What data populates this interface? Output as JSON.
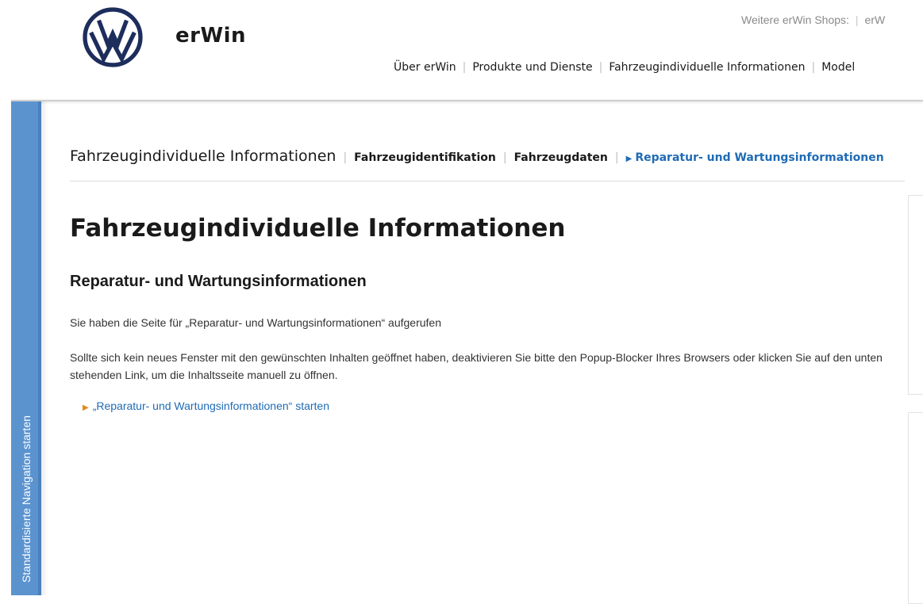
{
  "brand": {
    "name": "erWin",
    "logo": "vw-logo"
  },
  "shops": {
    "label": "Weitere erWin Shops:",
    "next": "erW"
  },
  "topnav": {
    "items": [
      "Über erWin",
      "Produkte und Dienste",
      "Fahrzeugindividuelle Informationen",
      "Model"
    ]
  },
  "sidetab": {
    "label": "Standardisierte Navigation starten",
    "color": "#5b93cf"
  },
  "subnav": {
    "main": "Fahrzeugindividuelle Informationen",
    "items": [
      "Fahrzeugidentifikation",
      "Fahrzeugdaten"
    ],
    "active": "Reparatur- und Wartungsinformationen"
  },
  "content": {
    "title": "Fahrzeugindividuelle Informationen",
    "section_title": "Reparatur- und Wartungsinformationen",
    "para1": "Sie haben die Seite für „Reparatur- und Wartungsinformationen“ aufgerufen",
    "para2": "Sollte sich kein neues Fenster mit den gewünschten Inhalten geöffnet haben, deaktivieren Sie bitte den Popup-Blocker Ihres Browsers oder klicken Sie auf den unten stehenden Link, um die Inhaltsseite manuell zu öffnen.",
    "link": "„Reparatur- und Wartungsinformationen“ starten"
  },
  "colors": {
    "brand_blue": "#1d2d5c",
    "link": "#1f6bb5",
    "link_arrow": "#e08a17"
  }
}
